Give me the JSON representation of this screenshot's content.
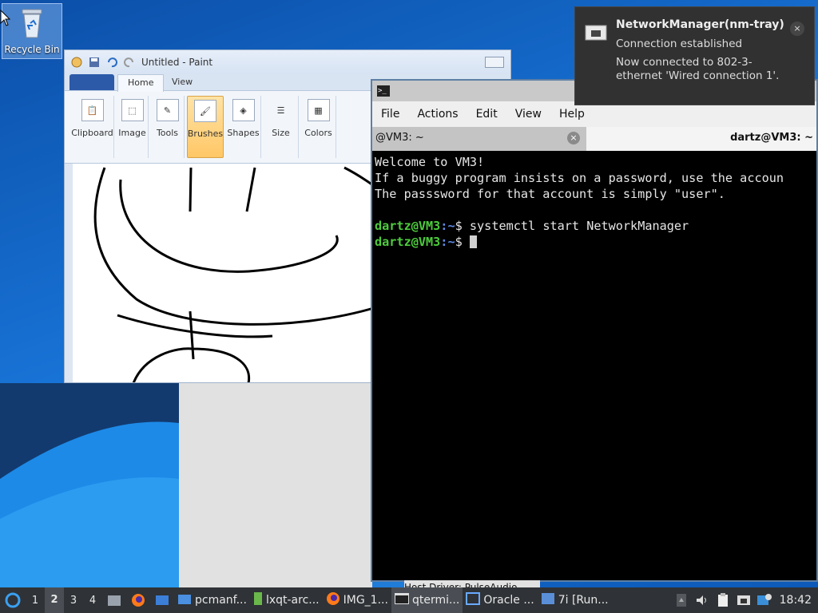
{
  "desktop": {
    "recycle_bin_label": "Recycle Bin"
  },
  "paint": {
    "title": "Untitled - Paint",
    "tabs": [
      "Home",
      "View"
    ],
    "groups": [
      "Clipboard",
      "Image",
      "Tools",
      "Brushes",
      "Shapes",
      "Size",
      "Colors"
    ],
    "selected_group": "Brushes"
  },
  "terminal": {
    "menu": [
      "File",
      "Actions",
      "Edit",
      "View",
      "Help"
    ],
    "tab1_title": "@VM3: ~",
    "tab2_title": "dartz@VM3: ~",
    "lines": {
      "l1": "Welcome to VM3!",
      "l2": "If a buggy program insists on a password, use the accoun",
      "l3": "The passsword for that account is simply \"user\".",
      "prompt_user": "dartz@VM3",
      "prompt_path": ":~",
      "prompt_sign": "$ ",
      "command": "systemctl start NetworkManager"
    }
  },
  "peek_text": "Host Driver:   PulseAudio",
  "notification": {
    "title": "NetworkManager(nm-tray)",
    "line1": "Connection established",
    "line2": "Now connected to 802-3-ethernet 'Wired connection 1'.",
    "close": "×"
  },
  "taskbar": {
    "desktops": [
      "1",
      "2",
      "3",
      "4"
    ],
    "current_desktop": "2",
    "tasks": [
      "pcmanf...",
      "lxqt-arc...",
      "IMG_1...",
      "qtermi...",
      "Oracle ...",
      "7i [Run..."
    ],
    "active_task": "qtermi...",
    "clock": "18:42"
  },
  "colors": {
    "prompt_user": "#4ccc3c",
    "prompt_path": "#5c8ae6",
    "taskbar": "#2f3236",
    "notification_bg": "#313131"
  }
}
